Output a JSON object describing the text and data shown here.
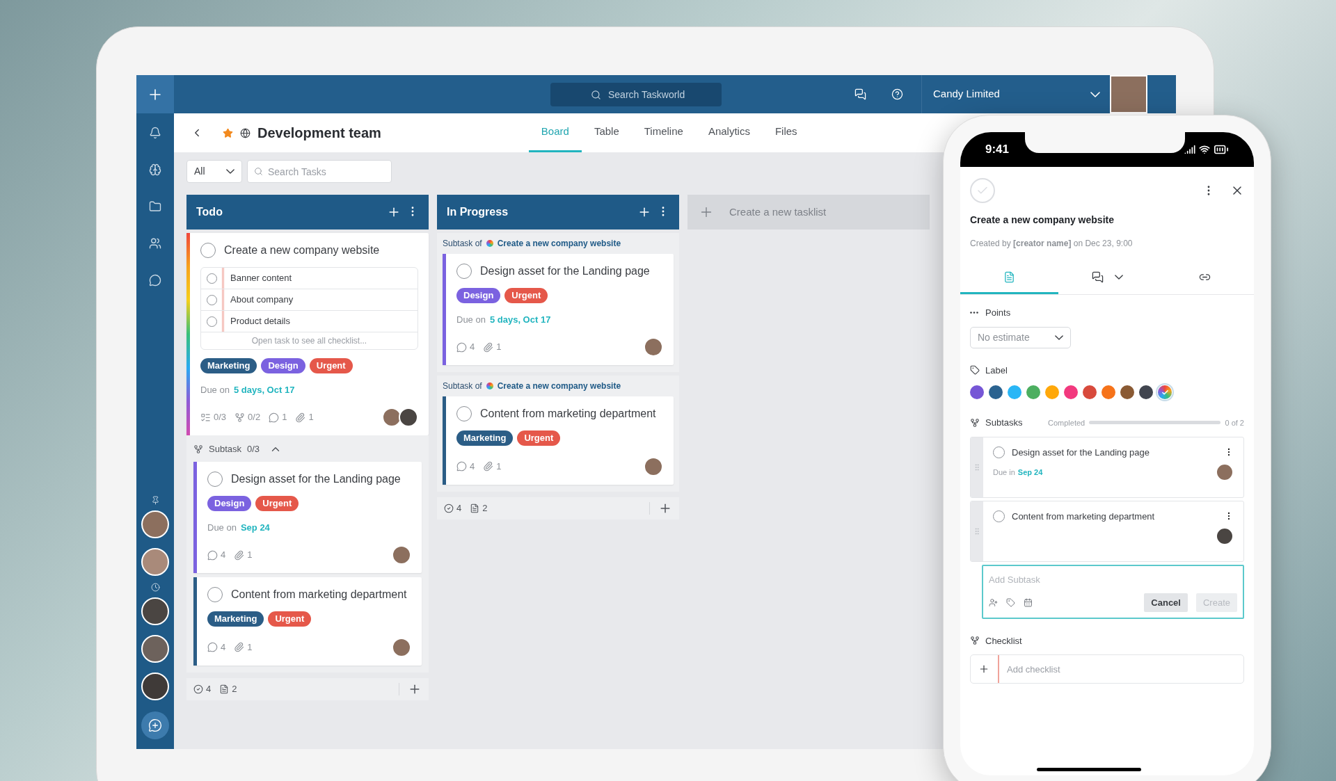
{
  "top_bar": {
    "search": {
      "placeholder": "Search Taskworld"
    },
    "workspace": "Candy Limited"
  },
  "project": {
    "title": "Development team",
    "starred": true
  },
  "tabs": [
    {
      "label": "Board",
      "selected": true
    },
    {
      "label": "Table",
      "selected": false
    },
    {
      "label": "Timeline",
      "selected": false
    },
    {
      "label": "Analytics",
      "selected": false
    },
    {
      "label": "Files",
      "selected": false
    }
  ],
  "filter": {
    "value": "All"
  },
  "task_search": {
    "placeholder": "Search Tasks"
  },
  "tasklists": [
    {
      "title": "Todo",
      "cards": [
        {
          "multicolor": true,
          "title": "Create a new company website",
          "done": false,
          "checklist": [
            {
              "text": "Banner content",
              "checked": false
            },
            {
              "text": "About company",
              "checked": false
            },
            {
              "text": "Product details",
              "checked": false
            }
          ],
          "checklist_more": "Open task to see all checklist...",
          "tags": [
            {
              "text": "Marketing",
              "color": "#2b5d86"
            },
            {
              "text": "Design",
              "color": "#7b62e0"
            },
            {
              "text": "Urgent",
              "color": "#e5584a"
            }
          ],
          "due": {
            "label": "Due on",
            "value": "5 days, Oct 17"
          },
          "stats": [
            {
              "kind": "checklist",
              "text": "0/3"
            },
            {
              "kind": "subtask",
              "text": "0/2"
            },
            {
              "kind": "comment",
              "text": "1"
            },
            {
              "kind": "attachment",
              "text": "1"
            }
          ],
          "assignees": [
            {
              "kind": "avatar"
            },
            {
              "kind": "avatar"
            }
          ],
          "subtask_group": {
            "label": "Subtask",
            "count": "0/3",
            "expanded": true,
            "cards": [
              {
                "color": "#7b62e0",
                "title": "Design asset for the Landing page",
                "done": false,
                "tags": [
                  {
                    "text": "Design",
                    "color": "#7b62e0"
                  },
                  {
                    "text": "Urgent",
                    "color": "#e5584a"
                  }
                ],
                "due": {
                  "label": "Due on",
                  "value": "Sep 24"
                },
                "stats": [
                  {
                    "kind": "comment",
                    "text": "4"
                  },
                  {
                    "kind": "attachment",
                    "text": "1"
                  }
                ],
                "assignees": [
                  {
                    "kind": "avatar"
                  }
                ]
              },
              {
                "color": "#2b5d86",
                "title": "Content from marketing department",
                "done": false,
                "tags": [
                  {
                    "text": "Marketing",
                    "color": "#2b5d86"
                  },
                  {
                    "text": "Urgent",
                    "color": "#e5584a"
                  }
                ],
                "stats": [
                  {
                    "kind": "comment",
                    "text": "4"
                  },
                  {
                    "kind": "attachment",
                    "text": "1"
                  }
                ],
                "assignees": [
                  {
                    "kind": "avatar"
                  }
                ]
              }
            ]
          }
        }
      ],
      "footer": {
        "tasks": "4",
        "notes": "2"
      }
    },
    {
      "title": "In Progress",
      "cards": [
        {
          "parent": {
            "prefix": "Subtask of",
            "title": "Create a new company website"
          },
          "color": "#7b62e0",
          "title": "Design asset for the Landing page",
          "done": false,
          "tags": [
            {
              "text": "Design",
              "color": "#7b62e0"
            },
            {
              "text": "Urgent",
              "color": "#e5584a"
            }
          ],
          "due": {
            "label": "Due on",
            "value": "5 days, Oct 17"
          },
          "stats": [
            {
              "kind": "comment",
              "text": "4"
            },
            {
              "kind": "attachment",
              "text": "1"
            }
          ],
          "assignees": [
            {
              "kind": "avatar"
            }
          ]
        },
        {
          "parent": {
            "prefix": "Subtask of",
            "title": "Create a new company website"
          },
          "color": "#2b5d86",
          "title": "Content from marketing department",
          "done": false,
          "tags": [
            {
              "text": "Marketing",
              "color": "#2b5d86"
            },
            {
              "text": "Urgent",
              "color": "#e5584a"
            }
          ],
          "stats": [
            {
              "kind": "comment",
              "text": "4"
            },
            {
              "kind": "attachment",
              "text": "1"
            }
          ],
          "assignees": [
            {
              "kind": "avatar"
            }
          ]
        }
      ],
      "footer": {
        "tasks": "4",
        "notes": "2"
      }
    }
  ],
  "new_tasklist": "Create a new tasklist",
  "phone": {
    "time": "9:41",
    "task": {
      "title": "Create a new company website",
      "done": false,
      "created": "Created by **[creator name]** on Dec 23, 9:00"
    },
    "tabs": [
      {
        "kind": "details",
        "selected": true
      },
      {
        "kind": "comments",
        "selected": false
      },
      {
        "kind": "links",
        "selected": false
      }
    ],
    "points": {
      "label": "Points",
      "value": "No estimate"
    },
    "label": {
      "title": "Label",
      "swatches": [
        {
          "kind": "solid",
          "color": "#7656d6",
          "selected": false
        },
        {
          "kind": "solid",
          "color": "#2b6390",
          "selected": false
        },
        {
          "kind": "solid",
          "color": "#29b6f6",
          "selected": false
        },
        {
          "kind": "solid",
          "color": "#4caf60",
          "selected": false
        },
        {
          "kind": "solid",
          "color": "#ffa80a",
          "selected": false
        },
        {
          "kind": "solid",
          "color": "#f2397e",
          "selected": false
        },
        {
          "kind": "solid",
          "color": "#d84a3c",
          "selected": false
        },
        {
          "kind": "solid",
          "color": "#f6731a",
          "selected": false
        },
        {
          "kind": "solid",
          "color": "#8a5a34",
          "selected": false
        },
        {
          "kind": "solid",
          "color": "#41454f",
          "selected": false
        },
        {
          "kind": "multicolor",
          "selected": true
        }
      ]
    },
    "subtasks": {
      "title": "Subtasks",
      "progress_label": "Completed",
      "level": 0,
      "count": "0 of 2",
      "items": [
        {
          "title": "Design asset for the Landing page",
          "done": false,
          "due": {
            "label": "Due in",
            "value": "Sep 24"
          }
        },
        {
          "title": "Content from marketing department",
          "done": false
        }
      ],
      "new": {
        "placeholder": "Add Subtask",
        "cancel": {
          "label": "Cancel",
          "disabled": false
        },
        "create": {
          "label": "Create",
          "disabled": true
        }
      }
    },
    "checklist": {
      "title": "Checklist",
      "placeholder": "Add checklist"
    }
  }
}
